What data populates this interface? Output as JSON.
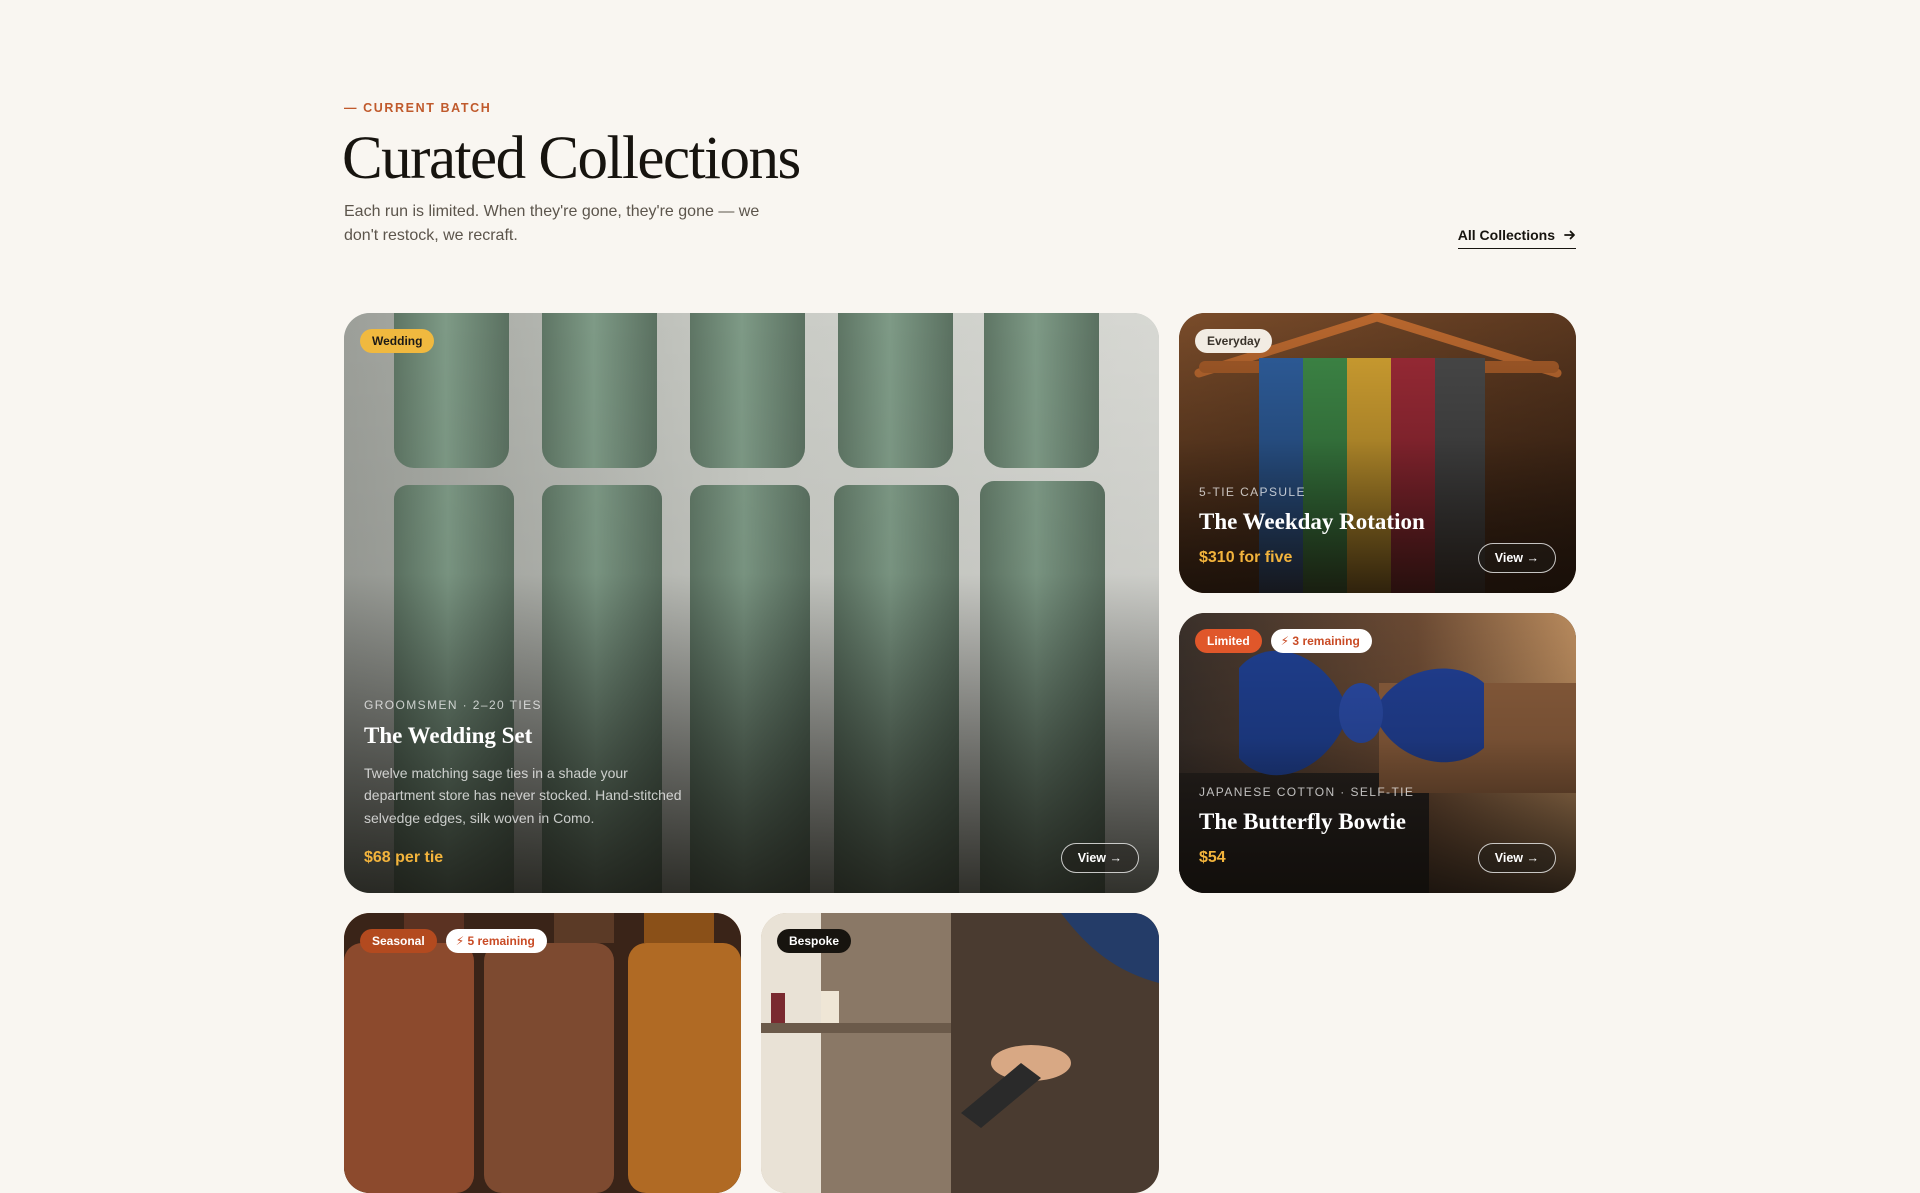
{
  "header": {
    "eyebrow": "— CURRENT BATCH",
    "title": "Curated Collections",
    "subtitle": "Each run is limited. When they're gone, they're gone — we don't restock, we recraft.",
    "all_link": "All Collections"
  },
  "colors": {
    "accent": "#c05a2c",
    "price": "#f3b43c",
    "badge_wedding": "#f0b93f",
    "badge_limited": "#e0572a",
    "badge_seasonal": "#b34a1f",
    "badge_bespoke": "#17140f"
  },
  "cards": [
    {
      "badge": "Wedding",
      "meta": "GROOMSMEN · 2–20 TIES",
      "name": "The Wedding Set",
      "desc": "Twelve matching sage ties in a shade your department store has never stocked. Hand-stitched selvedge edges, silk woven in Como.",
      "price": "$68 per tie",
      "view": "View →"
    },
    {
      "badge": "Everyday",
      "meta": "5-TIE CAPSULE",
      "name": "The Weekday Rotation",
      "price": "$310 for five",
      "view": "View →"
    },
    {
      "badge": "Limited",
      "stock": "⚡ 3 remaining",
      "meta": "JAPANESE COTTON · SELF-TIE",
      "name": "The Butterfly Bowtie",
      "price": "$54",
      "view": "View →"
    },
    {
      "badge": "Seasonal",
      "stock": "⚡ 5 remaining"
    },
    {
      "badge": "Bespoke"
    }
  ]
}
